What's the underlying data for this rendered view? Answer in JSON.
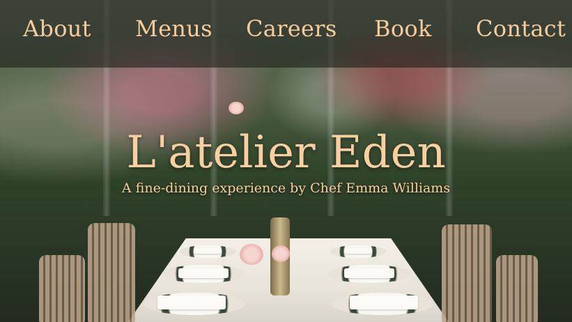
{
  "nav": {
    "items": [
      {
        "label": "About"
      },
      {
        "label": "Menus"
      },
      {
        "label": "Careers"
      },
      {
        "label": "Book"
      },
      {
        "label": "Contact"
      }
    ]
  },
  "hero": {
    "title": "L'atelier Eden",
    "subtitle": "A fine-dining experience by Chef Emma Williams"
  },
  "colors": {
    "accent": "#f8cfa0",
    "navbar_overlay": "#1e201c"
  }
}
